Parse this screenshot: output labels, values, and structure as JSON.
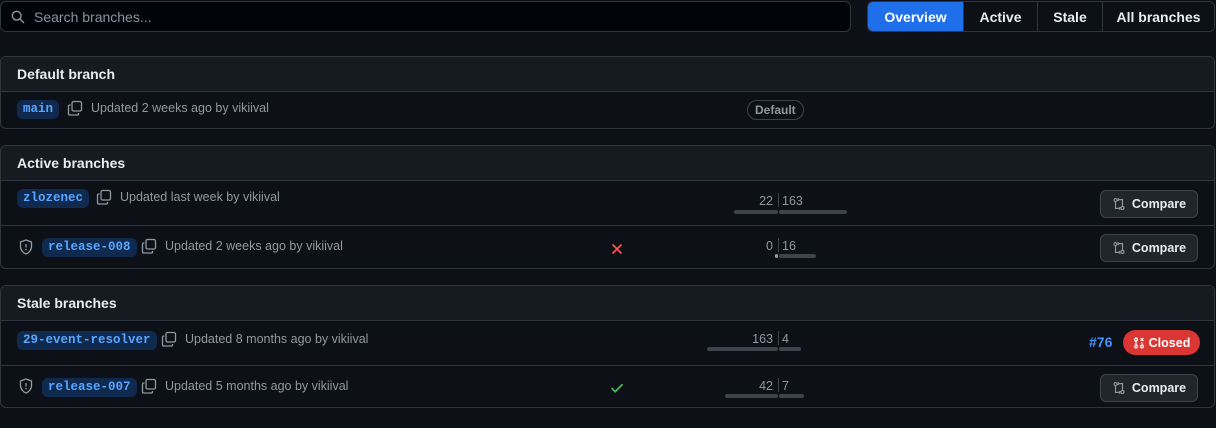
{
  "search": {
    "placeholder": "Search branches..."
  },
  "tabs": [
    {
      "label": "Overview",
      "selected": true
    },
    {
      "label": "Active",
      "selected": false
    },
    {
      "label": "Stale",
      "selected": false
    },
    {
      "label": "All branches",
      "selected": false
    }
  ],
  "sections": {
    "default": {
      "title": "Default branch",
      "rows": [
        {
          "name": "main",
          "meta": "Updated 2 weeks ago by vikiival",
          "badge": "Default",
          "protected": false
        }
      ]
    },
    "active": {
      "title": "Active branches",
      "rows": [
        {
          "name": "zlozenec",
          "meta": "Updated last week by vikiival",
          "behind": "22",
          "ahead": "163",
          "protected": false,
          "action": "Compare",
          "status": ""
        },
        {
          "name": "release-008",
          "meta": "Updated 2 weeks ago by vikiival",
          "behind": "0",
          "ahead": "16",
          "protected": true,
          "action": "Compare",
          "status": "failing"
        }
      ]
    },
    "stale": {
      "title": "Stale branches",
      "rows": [
        {
          "name": "29-event-resolver",
          "meta": "Updated 8 months ago by vikiival",
          "behind": "163",
          "ahead": "4",
          "protected": false,
          "pr_number": "#76",
          "pr_status": "Closed"
        },
        {
          "name": "release-007",
          "meta": "Updated 5 months ago by vikiival",
          "behind": "42",
          "ahead": "7",
          "protected": true,
          "action": "Compare",
          "status": "passing"
        }
      ]
    }
  },
  "colors": {
    "accent": "#1f6feb",
    "link": "#4493f8",
    "danger": "#da3633",
    "success": "#3fb950",
    "fail": "#f85149"
  },
  "icons": [
    "search-icon",
    "copy-icon",
    "shield-icon",
    "x-icon",
    "check-icon",
    "compare-icon",
    "pr-closed-icon"
  ]
}
